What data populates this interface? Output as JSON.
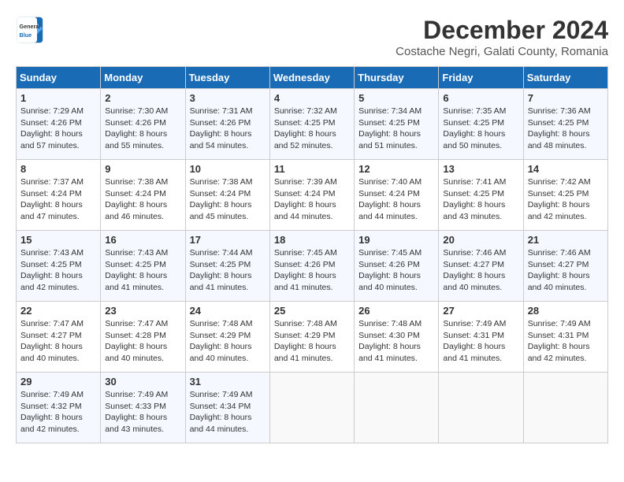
{
  "header": {
    "logo_line1": "General",
    "logo_line2": "Blue",
    "month": "December 2024",
    "location": "Costache Negri, Galati County, Romania"
  },
  "weekdays": [
    "Sunday",
    "Monday",
    "Tuesday",
    "Wednesday",
    "Thursday",
    "Friday",
    "Saturday"
  ],
  "weeks": [
    [
      {
        "day": "1",
        "sunrise": "7:29 AM",
        "sunset": "4:26 PM",
        "daylight": "8 hours and 57 minutes."
      },
      {
        "day": "2",
        "sunrise": "7:30 AM",
        "sunset": "4:26 PM",
        "daylight": "8 hours and 55 minutes."
      },
      {
        "day": "3",
        "sunrise": "7:31 AM",
        "sunset": "4:26 PM",
        "daylight": "8 hours and 54 minutes."
      },
      {
        "day": "4",
        "sunrise": "7:32 AM",
        "sunset": "4:25 PM",
        "daylight": "8 hours and 52 minutes."
      },
      {
        "day": "5",
        "sunrise": "7:34 AM",
        "sunset": "4:25 PM",
        "daylight": "8 hours and 51 minutes."
      },
      {
        "day": "6",
        "sunrise": "7:35 AM",
        "sunset": "4:25 PM",
        "daylight": "8 hours and 50 minutes."
      },
      {
        "day": "7",
        "sunrise": "7:36 AM",
        "sunset": "4:25 PM",
        "daylight": "8 hours and 48 minutes."
      }
    ],
    [
      {
        "day": "8",
        "sunrise": "7:37 AM",
        "sunset": "4:24 PM",
        "daylight": "8 hours and 47 minutes."
      },
      {
        "day": "9",
        "sunrise": "7:38 AM",
        "sunset": "4:24 PM",
        "daylight": "8 hours and 46 minutes."
      },
      {
        "day": "10",
        "sunrise": "7:38 AM",
        "sunset": "4:24 PM",
        "daylight": "8 hours and 45 minutes."
      },
      {
        "day": "11",
        "sunrise": "7:39 AM",
        "sunset": "4:24 PM",
        "daylight": "8 hours and 44 minutes."
      },
      {
        "day": "12",
        "sunrise": "7:40 AM",
        "sunset": "4:24 PM",
        "daylight": "8 hours and 44 minutes."
      },
      {
        "day": "13",
        "sunrise": "7:41 AM",
        "sunset": "4:25 PM",
        "daylight": "8 hours and 43 minutes."
      },
      {
        "day": "14",
        "sunrise": "7:42 AM",
        "sunset": "4:25 PM",
        "daylight": "8 hours and 42 minutes."
      }
    ],
    [
      {
        "day": "15",
        "sunrise": "7:43 AM",
        "sunset": "4:25 PM",
        "daylight": "8 hours and 42 minutes."
      },
      {
        "day": "16",
        "sunrise": "7:43 AM",
        "sunset": "4:25 PM",
        "daylight": "8 hours and 41 minutes."
      },
      {
        "day": "17",
        "sunrise": "7:44 AM",
        "sunset": "4:25 PM",
        "daylight": "8 hours and 41 minutes."
      },
      {
        "day": "18",
        "sunrise": "7:45 AM",
        "sunset": "4:26 PM",
        "daylight": "8 hours and 41 minutes."
      },
      {
        "day": "19",
        "sunrise": "7:45 AM",
        "sunset": "4:26 PM",
        "daylight": "8 hours and 40 minutes."
      },
      {
        "day": "20",
        "sunrise": "7:46 AM",
        "sunset": "4:27 PM",
        "daylight": "8 hours and 40 minutes."
      },
      {
        "day": "21",
        "sunrise": "7:46 AM",
        "sunset": "4:27 PM",
        "daylight": "8 hours and 40 minutes."
      }
    ],
    [
      {
        "day": "22",
        "sunrise": "7:47 AM",
        "sunset": "4:27 PM",
        "daylight": "8 hours and 40 minutes."
      },
      {
        "day": "23",
        "sunrise": "7:47 AM",
        "sunset": "4:28 PM",
        "daylight": "8 hours and 40 minutes."
      },
      {
        "day": "24",
        "sunrise": "7:48 AM",
        "sunset": "4:29 PM",
        "daylight": "8 hours and 40 minutes."
      },
      {
        "day": "25",
        "sunrise": "7:48 AM",
        "sunset": "4:29 PM",
        "daylight": "8 hours and 41 minutes."
      },
      {
        "day": "26",
        "sunrise": "7:48 AM",
        "sunset": "4:30 PM",
        "daylight": "8 hours and 41 minutes."
      },
      {
        "day": "27",
        "sunrise": "7:49 AM",
        "sunset": "4:31 PM",
        "daylight": "8 hours and 41 minutes."
      },
      {
        "day": "28",
        "sunrise": "7:49 AM",
        "sunset": "4:31 PM",
        "daylight": "8 hours and 42 minutes."
      }
    ],
    [
      {
        "day": "29",
        "sunrise": "7:49 AM",
        "sunset": "4:32 PM",
        "daylight": "8 hours and 42 minutes."
      },
      {
        "day": "30",
        "sunrise": "7:49 AM",
        "sunset": "4:33 PM",
        "daylight": "8 hours and 43 minutes."
      },
      {
        "day": "31",
        "sunrise": "7:49 AM",
        "sunset": "4:34 PM",
        "daylight": "8 hours and 44 minutes."
      },
      null,
      null,
      null,
      null
    ]
  ]
}
